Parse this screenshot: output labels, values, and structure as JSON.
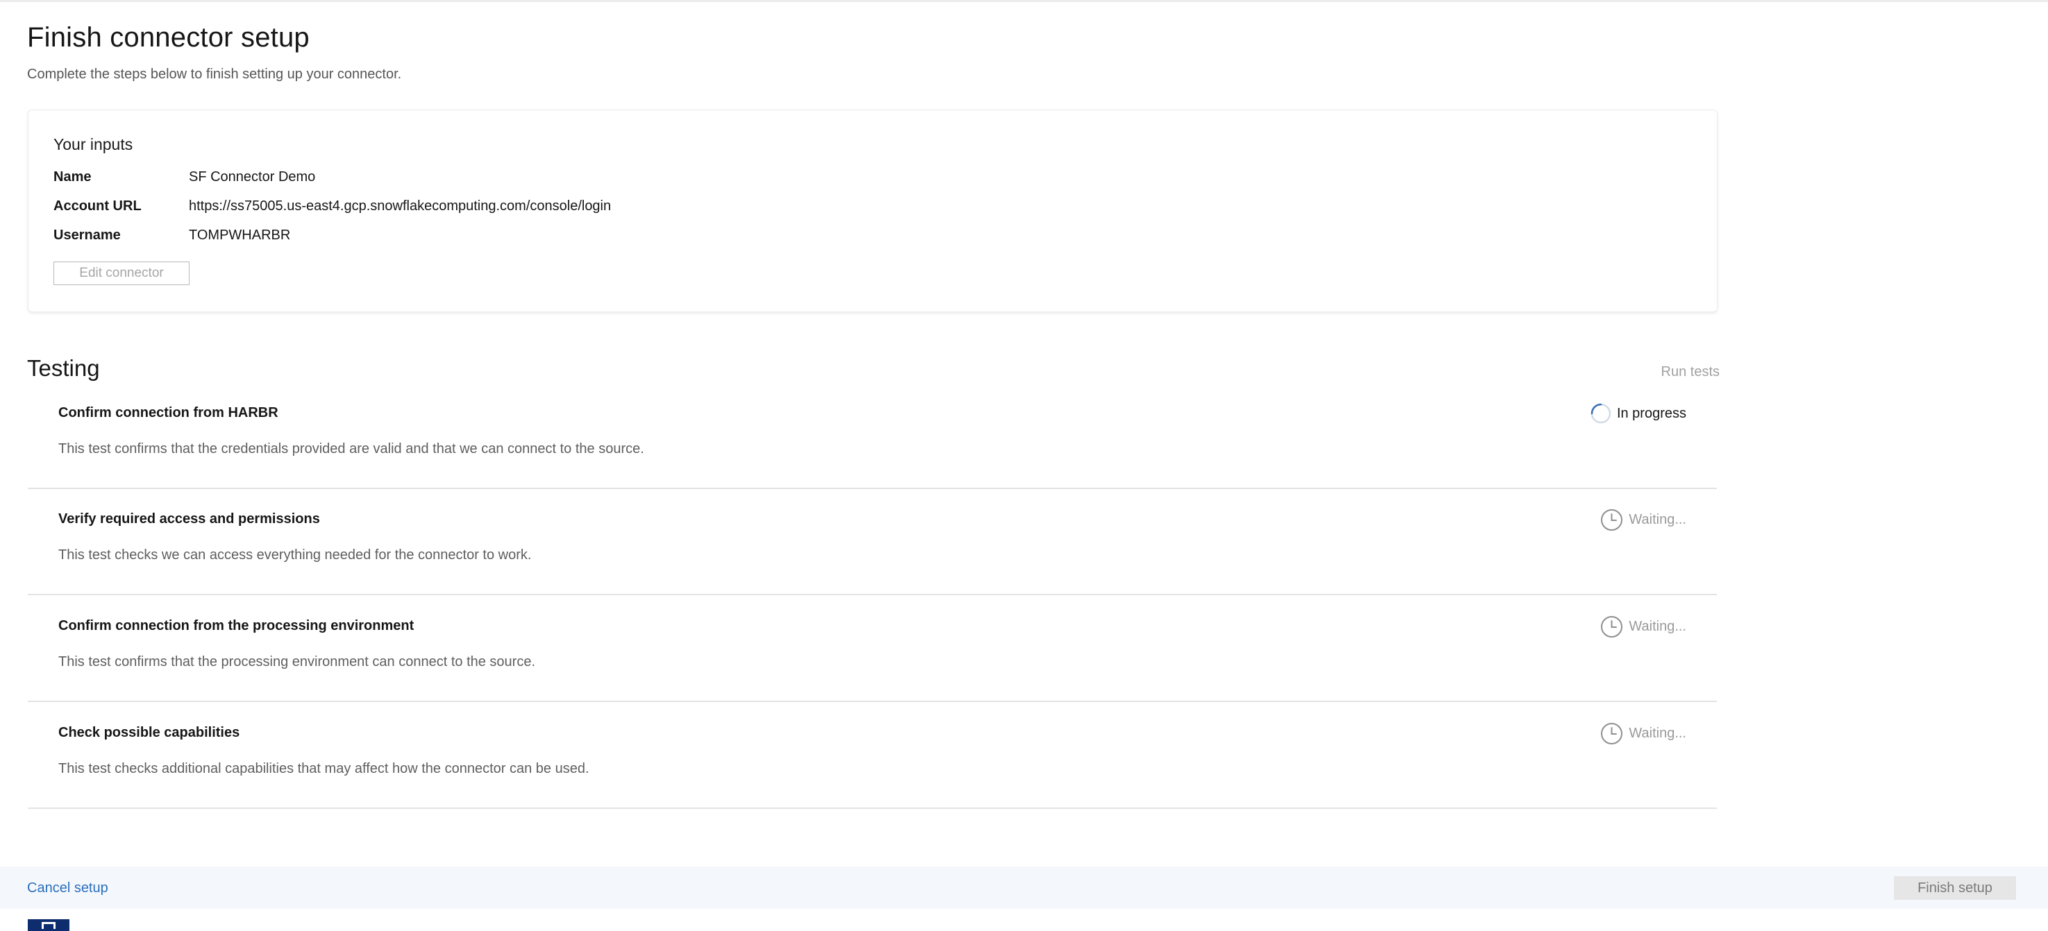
{
  "page": {
    "title": "Finish connector setup",
    "subtitle": "Complete the steps below to finish setting up your connector."
  },
  "inputs": {
    "title": "Your inputs",
    "fields": [
      {
        "label": "Name",
        "value": "SF Connector Demo"
      },
      {
        "label": "Account URL",
        "value": "https://ss75005.us-east4.gcp.snowflakecomputing.com/console/login"
      },
      {
        "label": "Username",
        "value": "TOMPWHARBR"
      }
    ],
    "edit_label": "Edit connector"
  },
  "testing": {
    "title": "Testing",
    "run_tests_label": "Run tests",
    "tests": [
      {
        "title": "Confirm connection from HARBR",
        "description": "This test confirms that the credentials provided are valid and that we can connect to the source.",
        "status": "In progress",
        "status_icon": "spinner-icon"
      },
      {
        "title": "Verify required access and permissions",
        "description": "This test checks we can access everything needed for the connector to work.",
        "status": "Waiting...",
        "status_icon": "clock-icon"
      },
      {
        "title": "Confirm connection from the processing environment",
        "description": "This test confirms that the processing environment can connect to the source.",
        "status": "Waiting...",
        "status_icon": "clock-icon"
      },
      {
        "title": "Check possible capabilities",
        "description": "This test checks additional capabilities that may affect how the connector can be used.",
        "status": "Waiting...",
        "status_icon": "clock-icon"
      }
    ]
  },
  "footer": {
    "cancel_label": "Cancel setup",
    "finish_label": "Finish setup"
  },
  "colors": {
    "link": "#2a6ebb",
    "spinner": "#3b6fb5",
    "footer_bg": "#f4f8fd",
    "brand": "#0d2d6e"
  }
}
